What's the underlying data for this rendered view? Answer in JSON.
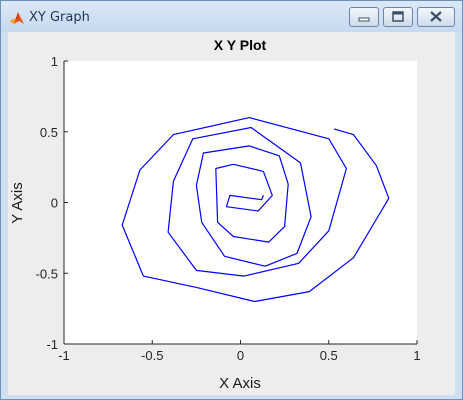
{
  "window": {
    "title": "XY Graph",
    "icon": "matlab-icon",
    "controls": [
      "minimize-icon",
      "maximize-icon",
      "close-icon"
    ]
  },
  "chart_data": {
    "type": "line",
    "title": "X Y Plot",
    "xlabel": "X Axis",
    "ylabel": "Y Axis",
    "xlim": [
      -1,
      1
    ],
    "ylim": [
      -1,
      1
    ],
    "xticks": [
      "-1",
      "-0.5",
      "0",
      "0.5",
      "1"
    ],
    "yticks": [
      "-1",
      "-0.5",
      "0",
      "0.5",
      "1"
    ],
    "grid": false,
    "colors": {
      "line": "#0000ff",
      "axes_bg": "#ffffff",
      "figure_bg": "#ededed"
    },
    "series": [
      {
        "x": [
          0.13,
          0.12,
          -0.06,
          -0.08,
          0.1,
          0.18,
          0.13,
          -0.04,
          -0.14,
          -0.13,
          -0.04,
          0.16,
          0.25,
          0.27,
          0.22,
          0.05,
          -0.21,
          -0.25,
          -0.22,
          -0.09,
          0.14,
          0.32,
          0.4,
          0.34,
          0.06,
          -0.27,
          -0.38,
          -0.41,
          -0.25,
          0.02,
          0.33,
          0.5,
          0.6,
          0.5,
          0.05,
          -0.38,
          -0.57,
          -0.67,
          -0.55,
          -0.25,
          0.08,
          0.39,
          0.64,
          0.84,
          0.77,
          0.64,
          0.53
        ],
        "y": [
          0.05,
          0.02,
          0.05,
          -0.03,
          -0.06,
          0.05,
          0.22,
          0.27,
          0.24,
          -0.14,
          -0.24,
          -0.28,
          -0.17,
          0.13,
          0.33,
          0.4,
          0.35,
          0.12,
          -0.14,
          -0.38,
          -0.45,
          -0.36,
          -0.1,
          0.28,
          0.53,
          0.45,
          0.15,
          -0.21,
          -0.48,
          -0.52,
          -0.43,
          -0.2,
          0.24,
          0.45,
          0.6,
          0.48,
          0.23,
          -0.16,
          -0.52,
          -0.6,
          -0.7,
          -0.63,
          -0.39,
          0.03,
          0.26,
          0.48,
          0.52
        ]
      }
    ]
  }
}
